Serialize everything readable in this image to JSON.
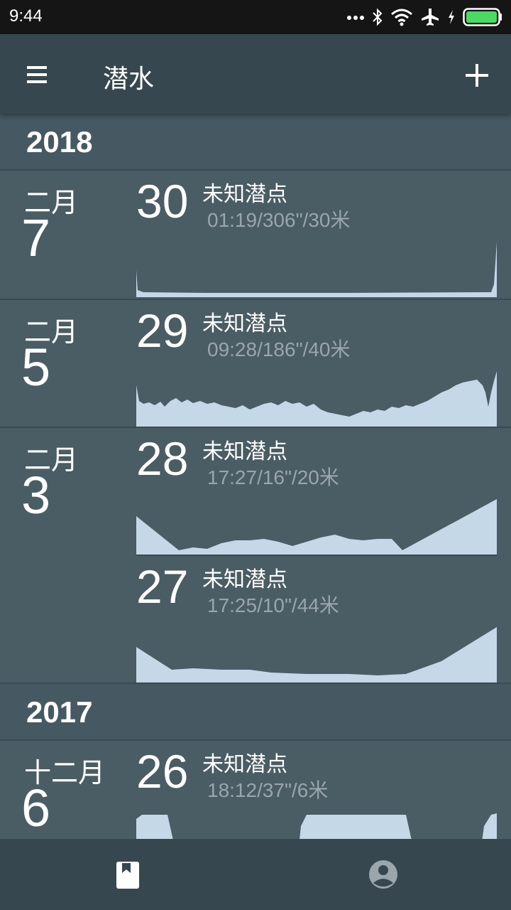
{
  "status_bar": {
    "time": "9:44",
    "icons": [
      "more-dots-icon",
      "bluetooth-icon",
      "wifi-icon",
      "airplane-mode-icon",
      "charging-icon",
      "battery-icon"
    ]
  },
  "app_bar": {
    "title": "潜水",
    "menu_icon": "hamburger-menu-icon",
    "add_icon": "plus-icon"
  },
  "colors": {
    "app_bar": "#37474f",
    "list_bg": "#4a5c64",
    "profile_fill": "#c5d8e8",
    "stats_text": "#9aa6ac",
    "battery": "#4cd964"
  },
  "log": {
    "years": [
      {
        "year": "2018",
        "days": [
          {
            "month": "二月",
            "day": "7",
            "dives": [
              {
                "number": "30",
                "site": "未知潜点",
                "stats": "01:19/306\"/30米"
              }
            ]
          },
          {
            "month": "二月",
            "day": "5",
            "dives": [
              {
                "number": "29",
                "site": "未知潜点",
                "stats": "09:28/186\"/40米"
              }
            ]
          },
          {
            "month": "二月",
            "day": "3",
            "dives": [
              {
                "number": "28",
                "site": "未知潜点",
                "stats": "17:27/16\"/20米"
              },
              {
                "number": "27",
                "site": "未知潜点",
                "stats": "17:25/10\"/44米"
              }
            ]
          }
        ]
      },
      {
        "year": "2017",
        "days": [
          {
            "month": "十二月",
            "day": "6",
            "dives": [
              {
                "number": "26",
                "site": "未知潜点",
                "stats": "18:12/37\"/6米"
              }
            ]
          }
        ]
      }
    ]
  },
  "bottom_nav": {
    "items": [
      {
        "icon": "logbook-icon",
        "selected": true
      },
      {
        "icon": "account-circle-icon",
        "selected": false
      }
    ]
  }
}
